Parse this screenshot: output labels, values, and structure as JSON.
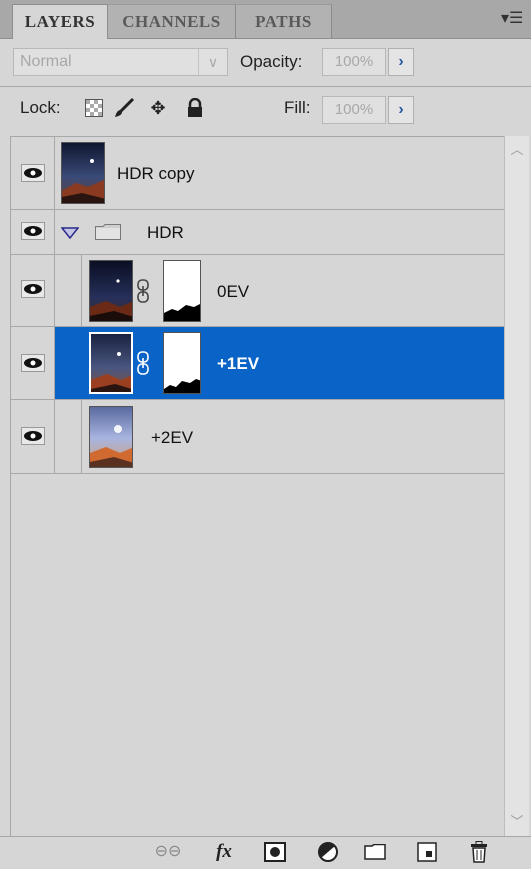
{
  "tabs": [
    {
      "label": "LAYERS",
      "active": true
    },
    {
      "label": "CHANNELS",
      "active": false
    },
    {
      "label": "PATHS",
      "active": false
    }
  ],
  "panel_menu_icon": "panel-menu-icon",
  "blend_mode": {
    "value": "Normal"
  },
  "opacity": {
    "label": "Opacity:",
    "value": "100%"
  },
  "lock": {
    "label": "Lock:",
    "icons": [
      "lock-transparent-icon",
      "lock-image-icon",
      "lock-position-icon",
      "lock-all-icon"
    ]
  },
  "fill": {
    "label": "Fill:",
    "value": "100%"
  },
  "layers": [
    {
      "name": "HDR copy",
      "visible": true,
      "selected": false,
      "type": "layer"
    },
    {
      "name": "HDR",
      "visible": true,
      "selected": false,
      "type": "group",
      "expanded": true
    },
    {
      "name": "0EV",
      "visible": true,
      "selected": false,
      "type": "layer-with-mask"
    },
    {
      "name": "+1EV",
      "visible": true,
      "selected": true,
      "type": "layer-with-mask"
    },
    {
      "name": "+2EV",
      "visible": true,
      "selected": false,
      "type": "layer"
    }
  ],
  "bottom_icons": [
    "link-layers-icon",
    "fx-icon",
    "add-mask-icon",
    "adjustment-layer-icon",
    "new-group-icon",
    "new-layer-icon",
    "delete-layer-icon"
  ],
  "colors": {
    "selection": "#0a64c8",
    "panel_bg": "#d6d6d6",
    "accent_arrow": "#2a5a9e"
  }
}
